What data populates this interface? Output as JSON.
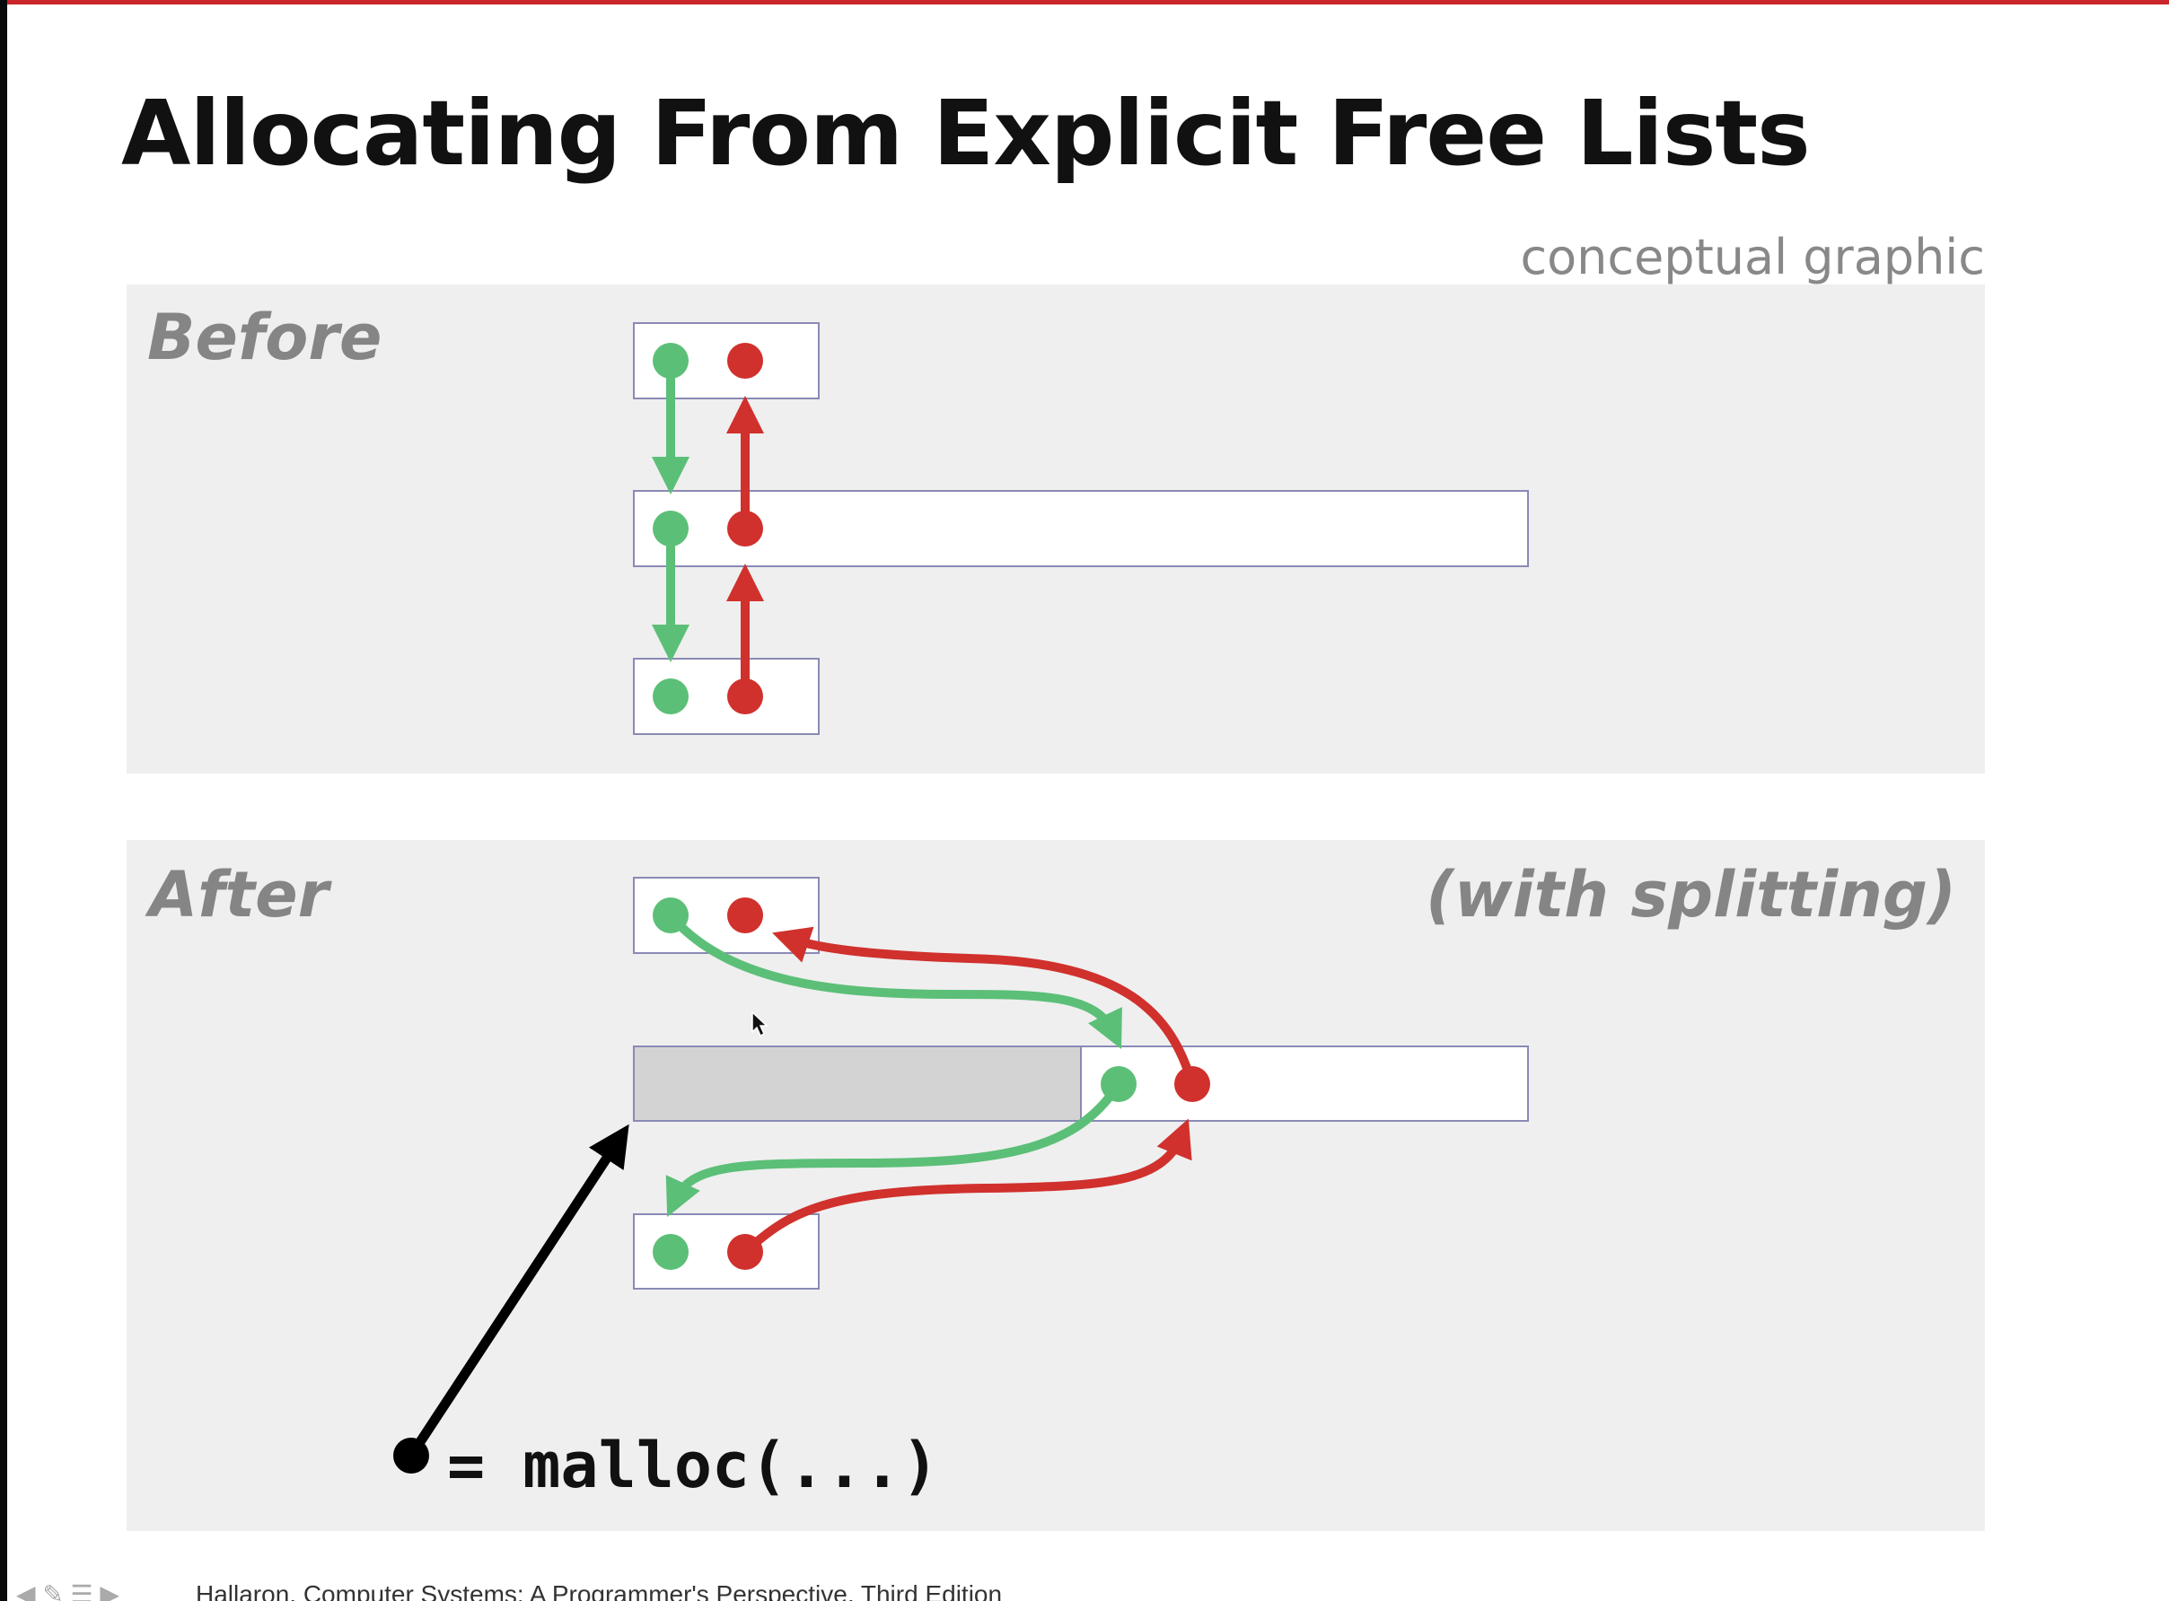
{
  "slide": {
    "title": "Allocating From Explicit Free Lists",
    "caption": "conceptual graphic",
    "footer": "Hallaron, Computer Systems: A Programmer's Perspective, Third Edition"
  },
  "panels": {
    "before": {
      "label": "Before"
    },
    "after": {
      "label": "After",
      "note": "(with splitting)"
    }
  },
  "call": {
    "text": "= malloc(...)"
  },
  "colors": {
    "next_pointer": "#5cbf78",
    "prev_pointer": "#d0312d",
    "allocated_block": "#d3d3d3",
    "free_block": "#ffffff",
    "block_border": "#8a8ab5",
    "panel_background": "#efefef",
    "accent": "#c8262b"
  },
  "icons": {
    "pointer_dot": "filled-circle",
    "pointer_arrow": "arrowhead"
  }
}
